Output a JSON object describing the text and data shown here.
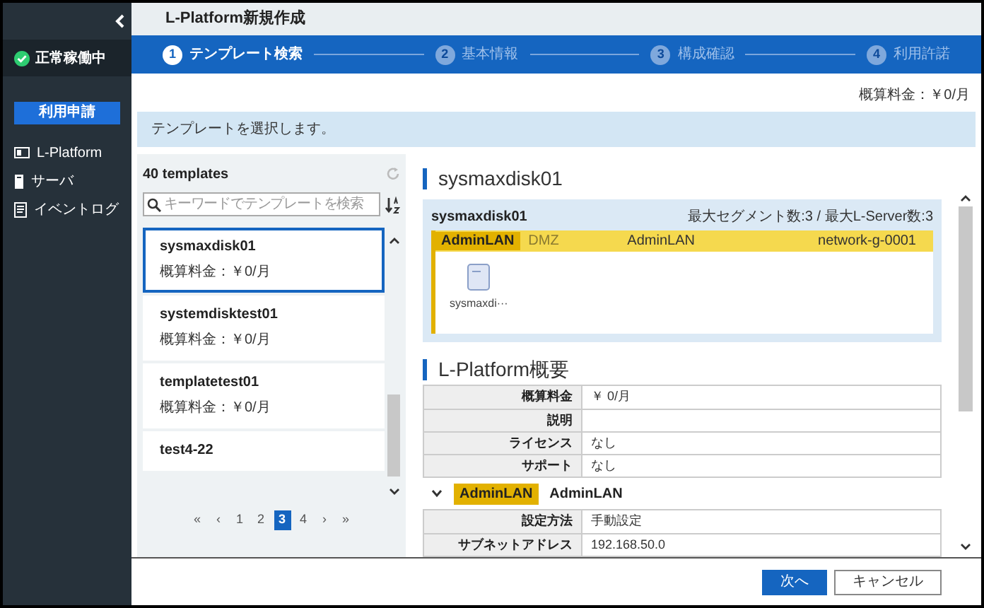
{
  "sidebar": {
    "status": "正常稼働中",
    "apply_button": "利用申請",
    "items": [
      {
        "label": "L-Platform"
      },
      {
        "label": "サーバ"
      },
      {
        "label": "イベントログ"
      }
    ]
  },
  "title": "L-Platform新規作成",
  "steps": [
    {
      "number": "1",
      "label": "テンプレート検索",
      "selected": true
    },
    {
      "number": "2",
      "label": "基本情報",
      "selected": false
    },
    {
      "number": "3",
      "label": "構成確認",
      "selected": false
    },
    {
      "number": "4",
      "label": "利用許諾",
      "selected": false
    }
  ],
  "estimate": "概算料金：￥0/月",
  "info": "テンプレートを選択します。",
  "templates": {
    "count": "40 templates",
    "search": {
      "placeholder": "キーワードでテンプレートを検索"
    },
    "items": [
      {
        "name": "sysmaxdisk01",
        "price": "概算料金：￥0/月",
        "selected": true
      },
      {
        "name": "systemdisktest01",
        "price": "概算料金：￥0/月",
        "selected": false
      },
      {
        "name": "templatetest01",
        "price": "概算料金：￥0/月",
        "selected": false
      },
      {
        "name": "test4-22",
        "selected": false
      }
    ],
    "pagination": [
      {
        "label": "«",
        "selected": false
      },
      {
        "label": "‹",
        "selected": false
      },
      {
        "label": "1",
        "selected": false
      },
      {
        "label": "2",
        "selected": false
      },
      {
        "label": "3",
        "selected": true
      },
      {
        "label": "4",
        "selected": false
      },
      {
        "label": "›",
        "selected": false
      },
      {
        "label": "»",
        "selected": false
      }
    ]
  },
  "detail": {
    "heading": "sysmaxdisk01",
    "diagram": {
      "name": "sysmaxdisk01",
      "limits": "最大セグメント数:3 / 最大L-Server数:3",
      "segment": {
        "badge": "AdminLAN",
        "type": "DMZ",
        "name": "AdminLAN",
        "network": "network-g-0001"
      },
      "server": "sysmaxdi···"
    },
    "overview_heading": "L-Platform概要",
    "overview": [
      {
        "label": "概算料金",
        "value": "￥ 0/月"
      },
      {
        "label": "説明"
      },
      {
        "label": "ライセンス",
        "value": "なし"
      },
      {
        "label": "サポート",
        "value": "なし"
      }
    ],
    "segment_section": {
      "expanded": true,
      "badge": "AdminLAN",
      "name": "AdminLAN",
      "rows": [
        {
          "label": "設定方法",
          "value": "手動設定"
        },
        {
          "label": "サブネットアドレス",
          "value": "192.168.50.0"
        }
      ]
    }
  },
  "buttons": [
    {
      "label": "次へ",
      "kind": "primary"
    },
    {
      "label": "キャンセル",
      "kind": "secondary"
    }
  ]
}
